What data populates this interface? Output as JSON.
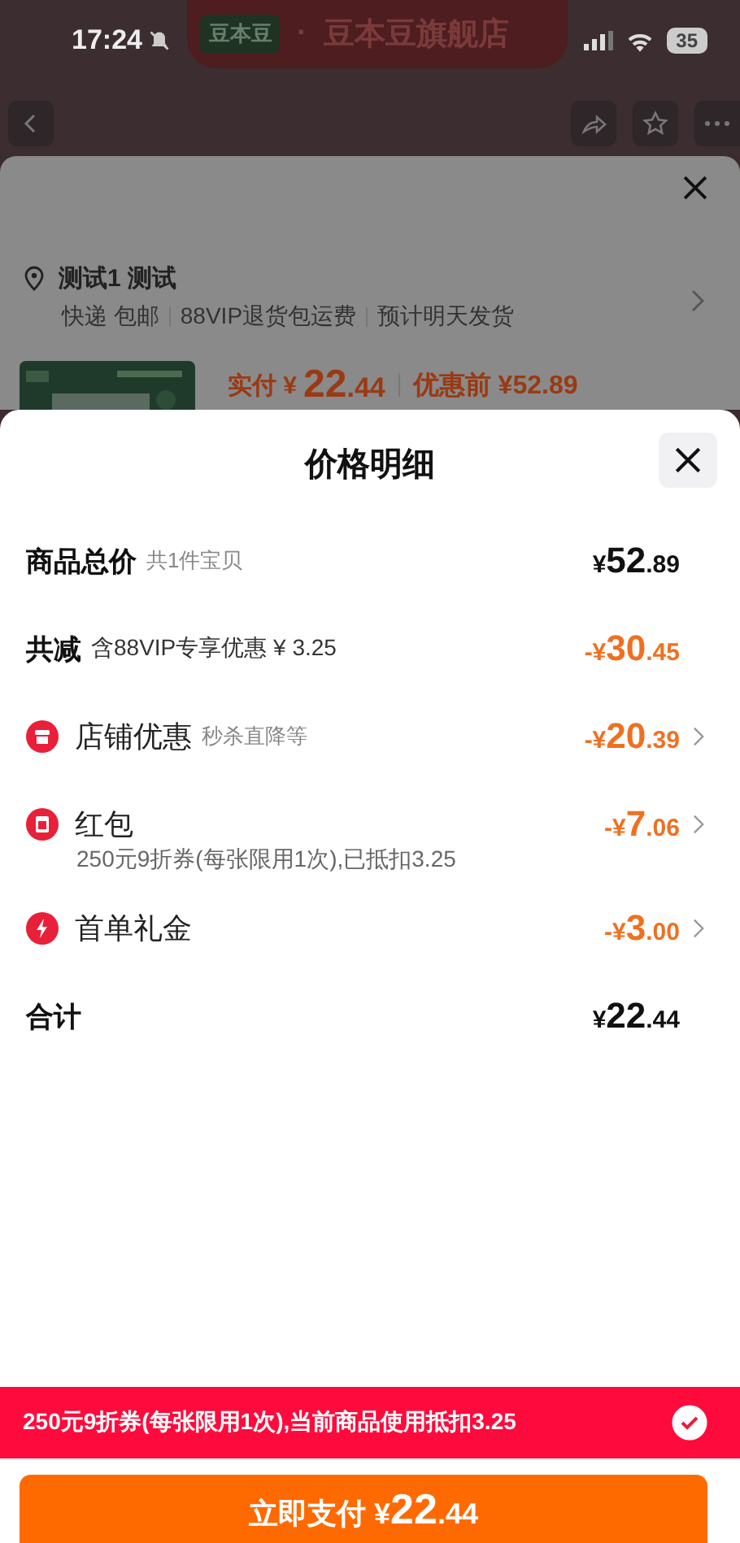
{
  "status_bar": {
    "time": "17:24",
    "battery": "35"
  },
  "store": {
    "logo": "豆本豆",
    "separator": "·",
    "name": "豆本豆旗舰店"
  },
  "order_sheet": {
    "address": "测试1 测试",
    "shipping": [
      "快递 包邮",
      "88VIP退货包运费",
      "预计明天发货"
    ],
    "paid_label": "实付",
    "paid": {
      "currency": "¥",
      "whole": "22",
      "fraction": ".44"
    },
    "original_label": "优惠前",
    "original": "¥52.89"
  },
  "price_detail": {
    "title": "价格明细",
    "rows": [
      {
        "label": "商品总价",
        "note": "共1件宝贝",
        "kind": "plain",
        "amount": {
          "currency": "¥",
          "whole": "52",
          "fraction": ".89"
        },
        "discount": false,
        "chevron": false
      },
      {
        "label": "共减",
        "note": "含88VIP专享优惠 ¥ 3.25",
        "kind": "plain",
        "amount": {
          "currency": "-¥",
          "whole": "30",
          "fraction": ".45"
        },
        "discount": true,
        "chevron": false
      },
      {
        "label": "店铺优惠",
        "note": "秒杀直降等",
        "kind": "shop",
        "amount": {
          "currency": "-¥",
          "whole": "20",
          "fraction": ".39"
        },
        "discount": true,
        "chevron": true
      },
      {
        "label": "红包",
        "sub": "250元9折券(每张限用1次),已抵扣3.25",
        "kind": "packet",
        "amount": {
          "currency": "-¥",
          "whole": "7",
          "fraction": ".06"
        },
        "discount": true,
        "chevron": true
      },
      {
        "label": "首单礼金",
        "kind": "bolt",
        "amount": {
          "currency": "-¥",
          "whole": "3",
          "fraction": ".00"
        },
        "discount": true,
        "chevron": true
      },
      {
        "label": "合计",
        "kind": "plain",
        "amount": {
          "currency": "¥",
          "whole": "22",
          "fraction": ".44"
        },
        "discount": false,
        "chevron": false
      }
    ]
  },
  "coupon_banner": {
    "text": "250元9折券(每张限用1次),当前商品使用抵扣3.25",
    "checked": true
  },
  "pay_button": {
    "label": "立即支付",
    "currency": "¥",
    "whole": "22",
    "fraction": ".44"
  }
}
